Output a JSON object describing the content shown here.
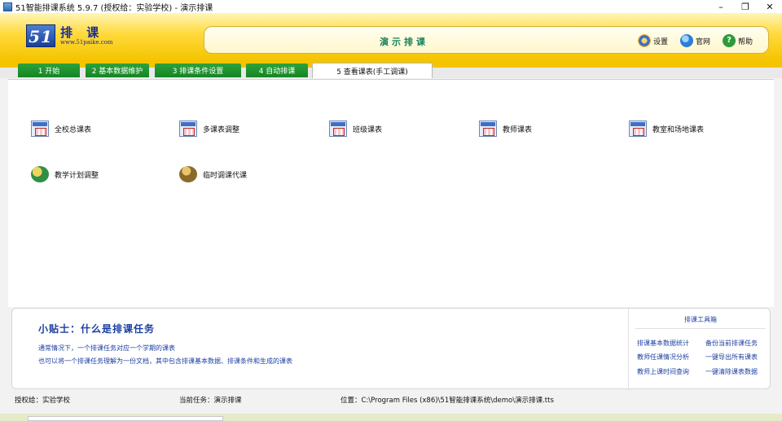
{
  "window": {
    "title": "51智能排课系统 5.9.7 (授权给：实验学校) - 演示排课",
    "controls": [
      "–",
      "❐",
      "✕"
    ]
  },
  "header": {
    "logo_number": "51",
    "logo_text": "排 课",
    "logo_url": "www.51paike.com",
    "center_title": "演示排课",
    "links": {
      "settings": "设置",
      "website": "官网",
      "help": "帮助"
    }
  },
  "tabs": [
    {
      "label": "1 开始"
    },
    {
      "label": "2 基本数据维护"
    },
    {
      "label": "3 排课条件设置"
    },
    {
      "label": "4 自动排课"
    },
    {
      "label": "5 查看课表(手工调课)"
    }
  ],
  "functions": [
    {
      "label": "全校总课表",
      "icon": "timetable-icon"
    },
    {
      "label": "多课表调整",
      "icon": "timetable-icon"
    },
    {
      "label": "班级课表",
      "icon": "class-schedule-icon"
    },
    {
      "label": "教师课表",
      "icon": "teacher-schedule-icon"
    },
    {
      "label": "教室和场地课表",
      "icon": "classroom-schedule-icon"
    },
    {
      "label": "教学计划调整",
      "icon": "teaching-plan-icon"
    },
    {
      "label": "临时调课代课",
      "icon": "substitute-icon"
    }
  ],
  "tip": {
    "title": "小贴士：什么是排课任务",
    "line1": "通常情况下，一个排课任务对应一个学期的课表",
    "line2": "也可以将一个排课任务理解为一份文档，其中包含排课基本数据、排课条件和生成的课表"
  },
  "toolbox": {
    "title": "排课工具箱",
    "items": [
      "排课基本数据统计",
      "备份当前排课任务",
      "教师任课情况分析",
      "一键导出所有课表",
      "教师上课时间查询",
      "一键清除课表数据"
    ]
  },
  "status": {
    "licensed": "授权给：实验学校",
    "task": "当前任务：演示排课",
    "location": "位置：C:\\Program Files (x86)\\51智能排课系统\\demo\\演示排课.tts"
  },
  "colors": {
    "header_yellow": "#f5c400",
    "tab_green": "#1f9430",
    "link_blue": "#1b3fa0"
  }
}
